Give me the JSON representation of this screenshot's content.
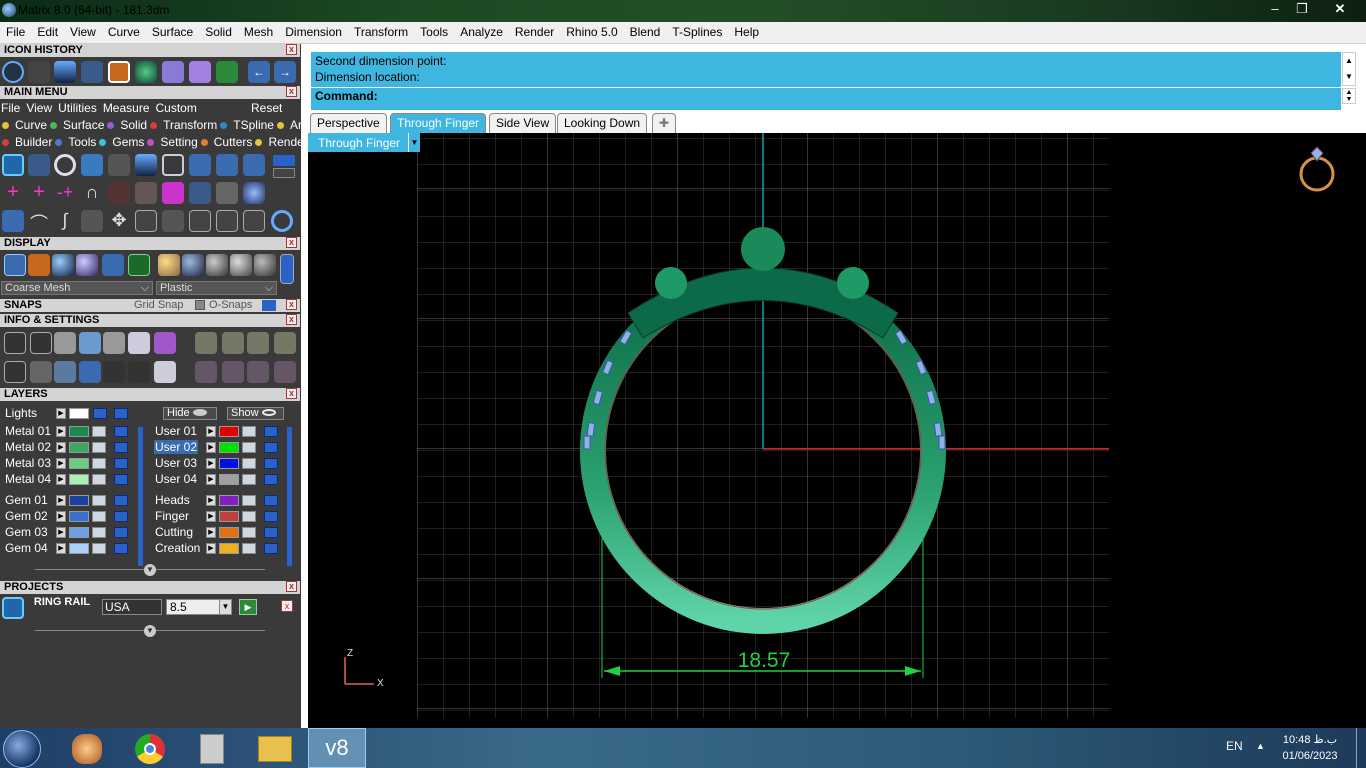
{
  "window": {
    "title": "Matrix 8.0 (64-bit) - 181.3dm"
  },
  "menu": [
    "File",
    "Edit",
    "View",
    "Curve",
    "Surface",
    "Solid",
    "Mesh",
    "Dimension",
    "Transform",
    "Tools",
    "Analyze",
    "Render",
    "Rhino 5.0",
    "Blend",
    "T-Splines",
    "Help"
  ],
  "panels": {
    "icon_history": "ICON HISTORY",
    "main_menu": "MAIN MENU",
    "display": "DISPLAY",
    "snaps": "SNAPS",
    "info_settings": "INFO & SETTINGS",
    "layers": "LAYERS",
    "projects": "PROJECTS"
  },
  "main_menu": {
    "items": [
      "File",
      "View",
      "Utilities",
      "Measure",
      "Custom"
    ],
    "reset": "Reset",
    "row1": [
      {
        "label": "Curve",
        "color": "#e2c43a"
      },
      {
        "label": "Surface",
        "color": "#4db84d"
      },
      {
        "label": "Solid",
        "color": "#9a5bd0"
      },
      {
        "label": "Transform",
        "color": "#d04040"
      },
      {
        "label": "TSpline",
        "color": "#2a8ad0"
      },
      {
        "label": "Art",
        "color": "#e2c43a"
      }
    ],
    "row2": [
      {
        "label": "Builder",
        "color": "#d04040"
      },
      {
        "label": "Tools",
        "color": "#4d7ad0"
      },
      {
        "label": "Gems",
        "color": "#3ac0e0"
      },
      {
        "label": "Setting",
        "color": "#c050c0"
      },
      {
        "label": "Cutters",
        "color": "#e08030"
      },
      {
        "label": "Render",
        "color": "#e2c43a"
      }
    ]
  },
  "display": {
    "mesh": "Coarse Mesh",
    "material": "Plastic"
  },
  "snaps": {
    "grid_snap": "Grid Snap",
    "osnaps": "O-Snaps"
  },
  "layers": {
    "lights": {
      "label": "Lights",
      "hide": "Hide",
      "show": "Show"
    },
    "left": [
      {
        "label": "Metal 01",
        "color": "#1a8a50"
      },
      {
        "label": "Metal 02",
        "color": "#3aa860"
      },
      {
        "label": "Metal 03",
        "color": "#6ad080"
      },
      {
        "label": "Metal 04",
        "color": "#a8f0b8"
      },
      {
        "label": "Gem 01",
        "color": "#1a40a0"
      },
      {
        "label": "Gem 02",
        "color": "#3a70d0"
      },
      {
        "label": "Gem 03",
        "color": "#6aa0e8"
      },
      {
        "label": "Gem 04",
        "color": "#a8d0f8"
      }
    ],
    "right": [
      {
        "label": "User 01",
        "color": "#e00000"
      },
      {
        "label": "User 02",
        "color": "#00e000"
      },
      {
        "label": "User 03",
        "color": "#0010e0"
      },
      {
        "label": "User 04",
        "color": "#a0a0a0"
      },
      {
        "label": "Heads",
        "color": "#8020c0"
      },
      {
        "label": "Finger",
        "color": "#c04040"
      },
      {
        "label": "Cutting",
        "color": "#e07010"
      },
      {
        "label": "Creation",
        "color": "#f0b020"
      }
    ],
    "selected": "User 02"
  },
  "projects": {
    "name": "RING RAIL",
    "region": "USA",
    "size": "8.5"
  },
  "command": {
    "line1": "Second dimension point:",
    "line2": "Dimension location:",
    "prompt": "Command:"
  },
  "tabs": [
    "Perspective",
    "Through Finger",
    "Side View",
    "Looking Down"
  ],
  "active_tab": "Through Finger",
  "viewport": {
    "label": "Through Finger",
    "dimension": "18.57",
    "axis_z": "Z",
    "axis_x": "X"
  },
  "taskbar": {
    "lang": "EN",
    "time": "10:48 ب.ظ",
    "date": "01/06/2023"
  }
}
